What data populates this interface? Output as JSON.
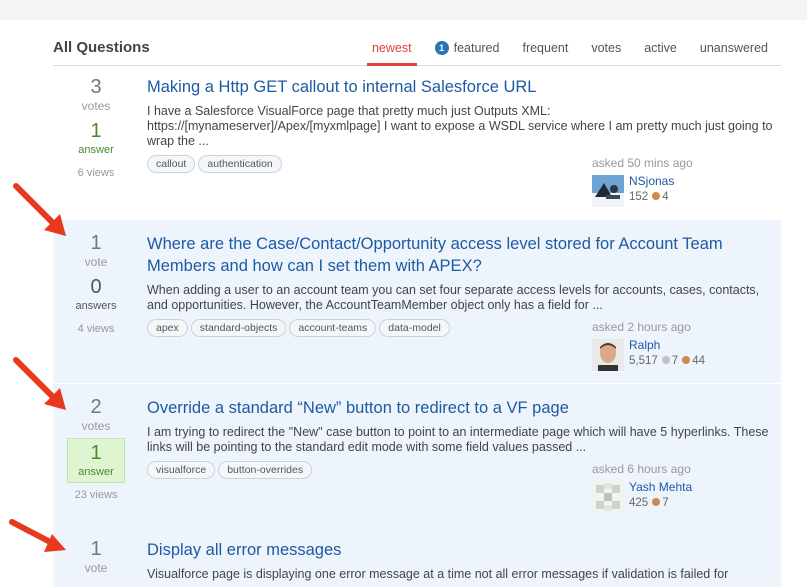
{
  "header": {
    "title": "All Questions"
  },
  "tabs": [
    {
      "label": "newest",
      "active": true
    },
    {
      "label": "featured",
      "badge": "1"
    },
    {
      "label": "frequent"
    },
    {
      "label": "votes"
    },
    {
      "label": "active"
    },
    {
      "label": "unanswered"
    }
  ],
  "questions": [
    {
      "votes": "3",
      "votes_unit": "votes",
      "answers": "1",
      "answers_unit": "answer",
      "views": "6 views",
      "title": "Making a Http GET callout to internal Salesforce URL",
      "excerpt": "I have a Salesforce VisualForce page that pretty much just Outputs XML: https://[mynameserver]/Apex/[myxmlpage] I want to expose a WSDL service where I am pretty much just going to wrap the ...",
      "tags": [
        "callout",
        "authentication"
      ],
      "asked": "asked 50 mins ago",
      "user": "NSjonas",
      "rep": "152",
      "bronze": "4"
    },
    {
      "votes": "1",
      "votes_unit": "vote",
      "answers": "0",
      "answers_unit": "answers",
      "views": "4 views",
      "title": "Where are the Case/Contact/Opportunity access level stored for Account Team Members and how can I set them with APEX?",
      "excerpt": "When adding a user to an account team you can set four separate access levels for accounts, cases, contacts, and opportunities. However, the AccountTeamMember object only has a field for ...",
      "tags": [
        "apex",
        "standard-objects",
        "account-teams",
        "data-model"
      ],
      "asked": "asked 2 hours ago",
      "user": "Ralph",
      "rep": "5,517",
      "silver": "7",
      "bronze": "44"
    },
    {
      "votes": "2",
      "votes_unit": "votes",
      "answers": "1",
      "answers_unit": "answer",
      "views": "23 views",
      "title": "Override a standard “New” button to redirect to a VF page",
      "excerpt": "I am trying to redirect the \"New\" case button to point to an intermediate page which will have 5 hyperlinks. These links will be pointing to the standard edit mode with some field values passed ...",
      "tags": [
        "visualforce",
        "button-overrides"
      ],
      "asked": "asked 6 hours ago",
      "user": "Yash Mehta",
      "rep": "425",
      "bronze": "7"
    },
    {
      "votes": "1",
      "votes_unit": "vote",
      "title": "Display all error messages",
      "excerpt": "Visualforce page is displaying one error message at a time not all error messages if validation is failed for"
    }
  ],
  "colors": {
    "link": "#1d5aa3",
    "active_tab": "#e2403a",
    "highlight_bg": "#eef4fb",
    "accepted_bg": "#dff5d2",
    "arrow": "#e8391f"
  },
  "icons": {
    "annotation": "red-arrow-icon"
  }
}
